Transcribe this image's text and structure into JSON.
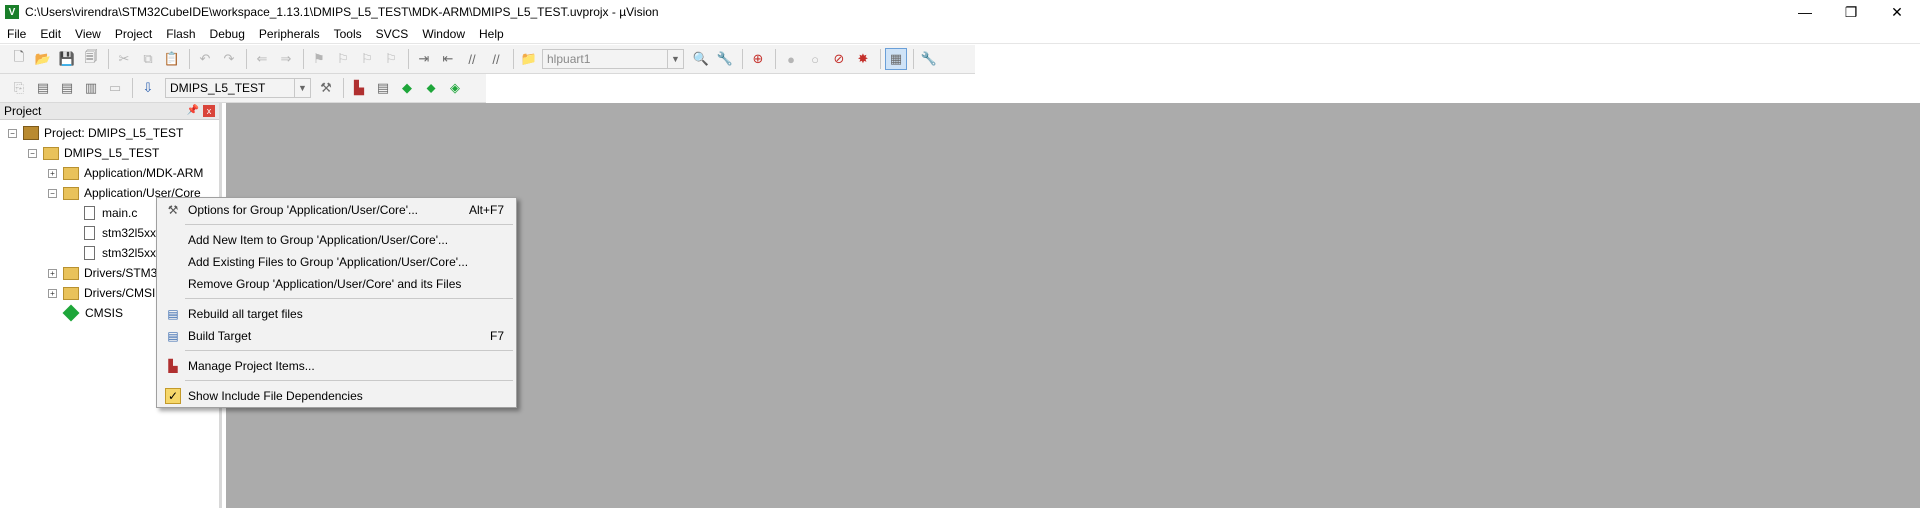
{
  "window": {
    "title": "C:\\Users\\virendra\\STM32CubeIDE\\workspace_1.13.1\\DMIPS_L5_TEST\\MDK-ARM\\DMIPS_L5_TEST.uvprojx - µVision",
    "app_icon": "V",
    "minimize": "—",
    "restore": "❐",
    "close": "✕"
  },
  "menu": [
    "File",
    "Edit",
    "View",
    "Project",
    "Flash",
    "Debug",
    "Peripherals",
    "Tools",
    "SVCS",
    "Window",
    "Help"
  ],
  "toolbar": {
    "find_combo": "hlpuart1",
    "target_combo": "DMIPS_L5_TEST"
  },
  "project_panel": {
    "title": "Project",
    "pin": "📌",
    "close": "x",
    "tree": [
      {
        "label": "Project: DMIPS_L5_TEST",
        "expander": "−"
      },
      {
        "label": "DMIPS_L5_TEST",
        "expander": "−"
      },
      {
        "label": "Application/MDK-ARM",
        "expander": "+"
      },
      {
        "label": "Application/User/Core",
        "expander": "−"
      },
      {
        "label": "main.c"
      },
      {
        "label": "stm32l5xx"
      },
      {
        "label": "stm32l5xx"
      },
      {
        "label": "Drivers/STM3",
        "expander": "+"
      },
      {
        "label": "Drivers/CMSI",
        "expander": "+"
      },
      {
        "label": "CMSIS"
      }
    ]
  },
  "context_menu": {
    "items": [
      {
        "label": "Options for Group 'Application/User/Core'...",
        "shortcut": "Alt+F7",
        "icon": "options-icon"
      },
      {
        "label": "Add New  Item to Group 'Application/User/Core'..."
      },
      {
        "label": "Add Existing Files to Group 'Application/User/Core'..."
      },
      {
        "label": "Remove Group 'Application/User/Core' and its Files"
      },
      {
        "label": "Rebuild all target files",
        "icon": "rebuild-icon"
      },
      {
        "label": "Build Target",
        "shortcut": "F7",
        "icon": "build-icon"
      },
      {
        "label": "Manage Project Items...",
        "icon": "manage-items-icon"
      },
      {
        "label": "Show Include File Dependencies",
        "icon": "checkmark-icon",
        "check": "✓"
      }
    ]
  },
  "colors": {
    "editor_bg": "#ababab",
    "toolbar_bg": "#f3f3f3",
    "menu_bg": "#f2f2f2"
  }
}
